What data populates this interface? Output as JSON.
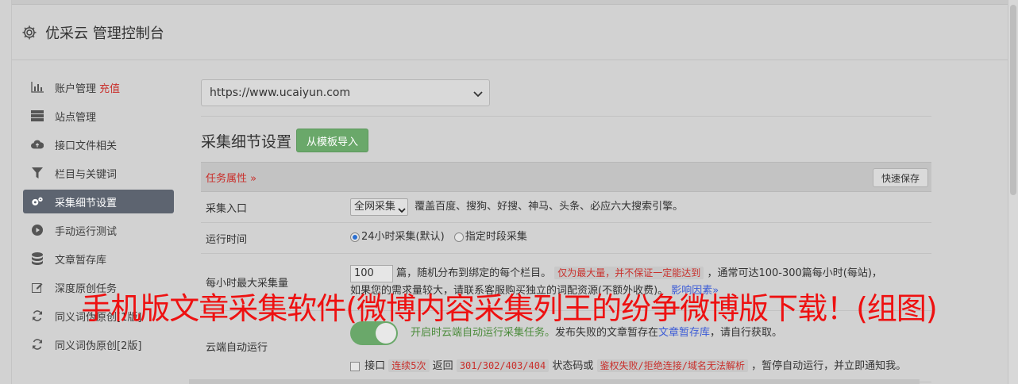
{
  "header": {
    "title": "优采云 管理控制台"
  },
  "sidebar": {
    "items": [
      {
        "label": "账户管理",
        "extra": "充值",
        "icon": "bar-chart-icon"
      },
      {
        "label": "站点管理",
        "icon": "server-icon"
      },
      {
        "label": "接口文件相关",
        "icon": "cloud-upload-icon"
      },
      {
        "label": "栏目与关键词",
        "icon": "filter-icon"
      },
      {
        "label": "采集细节设置",
        "icon": "gears-icon",
        "active": true
      },
      {
        "label": "手动运行测试",
        "icon": "play-circle-icon"
      },
      {
        "label": "文章暂存库",
        "icon": "database-icon"
      },
      {
        "label": "深度原创任务",
        "icon": "edit-icon"
      },
      {
        "label": "同义词伪原创[1版]",
        "icon": "refresh-icon"
      },
      {
        "label": "同义词伪原创[2版]",
        "icon": "refresh-icon"
      }
    ]
  },
  "main": {
    "site_select": "https://www.ucaiyun.com",
    "section_title": "采集细节设置",
    "import_button": "从模板导入",
    "table": {
      "header_task": "任务属性 »",
      "quick_save": "快速保存",
      "rows": {
        "entry": {
          "label": "采集入口",
          "select": "全网采集",
          "desc": "覆盖百度、搜狗、好搜、神马、头条、必应六大搜索引擎。"
        },
        "runtime": {
          "label": "运行时间",
          "opt1": "24小时采集(默认)",
          "opt2": "指定时段采集"
        },
        "max": {
          "label": "每小时最大采集量",
          "value": "100",
          "t1": "篇，随机分布到绑定的每个栏目。",
          "tag": "仅为最大量，并不保证一定能达到",
          "t2": "，通常可达100-300篇每小时(每站)，",
          "t3": "如果您的需求量较大，请联系客服购买独立的词配资源(不额外收费)。",
          "link": "影响因素»"
        },
        "auto": {
          "label": "云端自动运行",
          "green": "开启时云端自动运行采集任务。",
          "t1": "发布失败的文章暂存在",
          "link": "文章暂存库",
          "t2": "，请自行获取。",
          "c1": "接口",
          "tag1": "连续5次",
          "c2": "返回",
          "tag2": "301/302/403/404",
          "c3": "状态码或",
          "tag3": "鉴权失败/拒绝连接/域名无法解析",
          "c4": "，暂停自动运行，并立即通知我。"
        }
      }
    }
  },
  "overlay_title": "手机版文章采集软件(微博内容采集列王的纷争微博版下载！(组图)"
}
